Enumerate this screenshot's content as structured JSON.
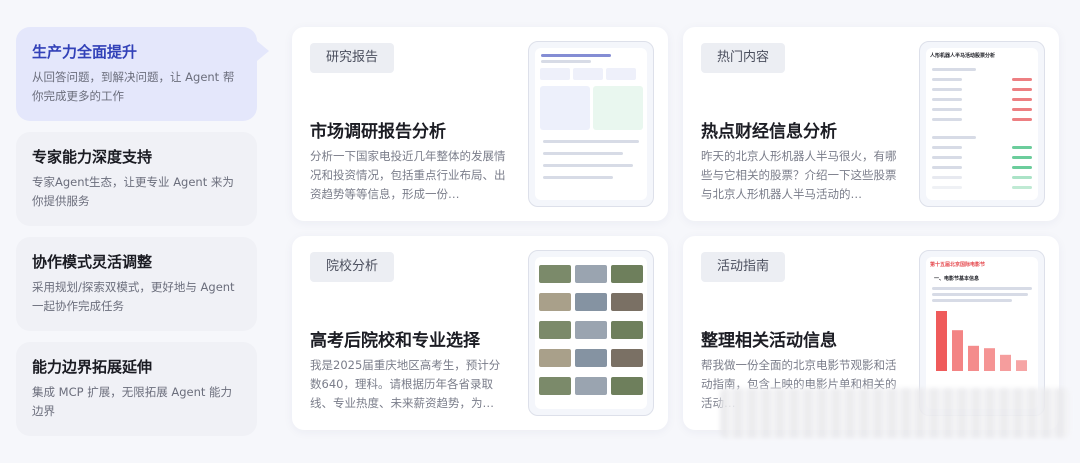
{
  "features": [
    {
      "title": "生产力全面提升",
      "desc": "从回答问题，到解决问题，让 Agent 帮你完成更多的工作",
      "active": true
    },
    {
      "title": "专家能力深度支持",
      "desc": "专家Agent生态，让更专业 Agent 来为你提供服务",
      "active": false
    },
    {
      "title": "协作模式灵活调整",
      "desc": "采用规划/探索双模式，更好地与 Agent 一起协作完成任务",
      "active": false
    },
    {
      "title": "能力边界拓展延伸",
      "desc": "集成 MCP 扩展，无限拓展 Agent 能力边界",
      "active": false
    }
  ],
  "cards": [
    {
      "tag": "研究报告",
      "title": "市场调研报告分析",
      "desc": "分析一下国家电投近几年整体的发展情况和投资情况，包括重点行业布局、出资趋势等等信息，形成一份…"
    },
    {
      "tag": "热门内容",
      "title": "热点财经信息分析",
      "desc": "昨天的北京人形机器人半马很火，有哪些与它相关的股票？介绍一下这些股票与北京人形机器人半马活动的…"
    },
    {
      "tag": "院校分析",
      "title": "高考后院校和专业选择",
      "desc": "我是2025届重庆地区高考生，预计分数640，理科。请根据历年各省录取线、专业热度、未来薪资趋势，为…"
    },
    {
      "tag": "活动指南",
      "title": "整理相关活动信息",
      "desc": "帮我做一份全面的北京电影节观影和活动指南，包含上映的电影片单和相关的活动…"
    }
  ],
  "thumbs": {
    "stocks_title": "人形机器人半马活动股票分析",
    "film_title": "第十五届北京国际电影节",
    "film_section": "一、电影节基本信息",
    "chart_values": [
      100,
      68,
      42,
      38,
      27,
      18
    ],
    "colors": {
      "accent": "#3241b8",
      "up": "#e5484d",
      "down": "#2eb872",
      "bar": "#ef5b5b"
    }
  }
}
